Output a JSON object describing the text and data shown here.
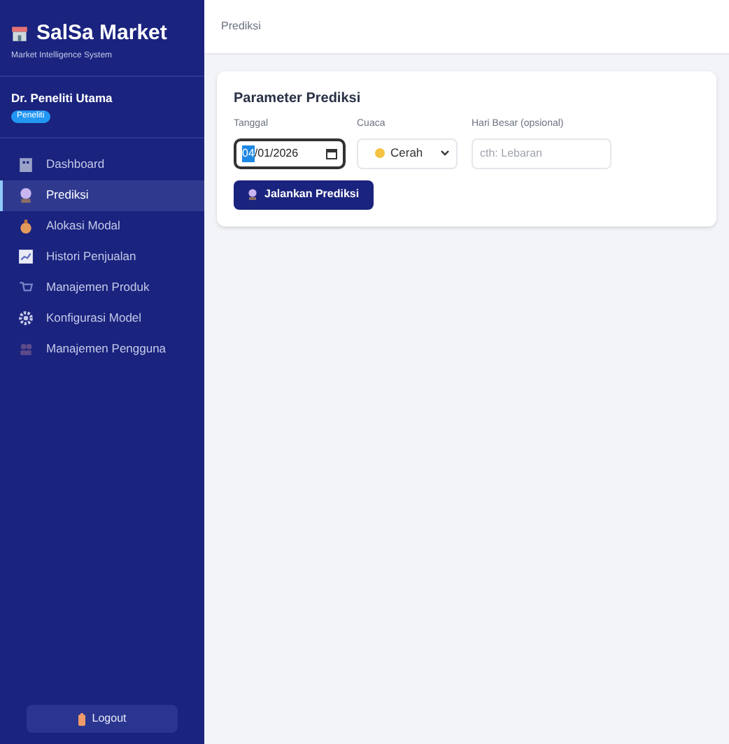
{
  "sidebar": {
    "brand": "SalSa Market",
    "tagline": "Market Intelligence System",
    "user": {
      "name": "Dr. Peneliti Utama",
      "role": "Peneliti"
    },
    "items": [
      {
        "label": "Dashboard",
        "selected": false
      },
      {
        "label": "Prediksi",
        "selected": true
      },
      {
        "label": "Alokasi Modal",
        "selected": false
      },
      {
        "label": "Histori Penjualan",
        "selected": false
      },
      {
        "label": "Manajemen Produk",
        "selected": false
      },
      {
        "label": "Konfigurasi Model",
        "selected": false
      },
      {
        "label": "Manajemen Pengguna",
        "selected": false
      }
    ],
    "logout": "Logout"
  },
  "topbar": {
    "title": "Prediksi"
  },
  "card": {
    "title": "Parameter Prediksi",
    "date": {
      "label": "Tanggal",
      "value_part_1": "04",
      "value_part_2": "/01/2026"
    },
    "weather": {
      "label": "Cuaca",
      "value": "Cerah"
    },
    "holiday": {
      "label": "Hari Besar (opsional)",
      "placeholder": "cth: Lebaran"
    },
    "button": "Jalankan Prediksi"
  }
}
